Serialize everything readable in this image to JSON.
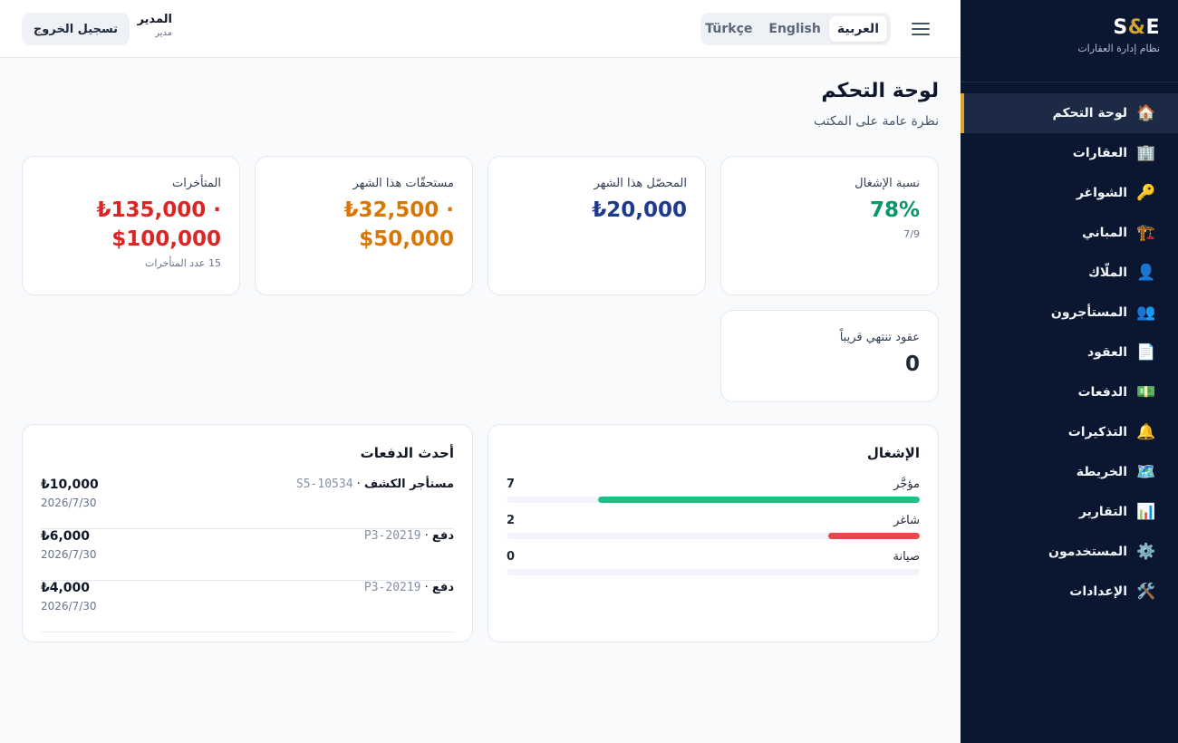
{
  "sidebar": {
    "brand_prefix": "S",
    "brand_amp": "&",
    "brand_suffix": "E",
    "subtitle": "نظام إدارة العقارات",
    "items": [
      {
        "label": "لوحة التحكم",
        "icon": "🏠",
        "icon_name": "home-icon"
      },
      {
        "label": "العقارات",
        "icon": "🏢",
        "icon_name": "building-icon"
      },
      {
        "label": "الشواغر",
        "icon": "🔑",
        "icon_name": "key-icon"
      },
      {
        "label": "المباني",
        "icon": "🏗️",
        "icon_name": "construction-icon"
      },
      {
        "label": "الملّاك",
        "icon": "👤",
        "icon_name": "user-icon"
      },
      {
        "label": "المستأجرون",
        "icon": "👥",
        "icon_name": "users-icon"
      },
      {
        "label": "العقود",
        "icon": "📄",
        "icon_name": "document-icon"
      },
      {
        "label": "الدفعات",
        "icon": "💵",
        "icon_name": "money-icon"
      },
      {
        "label": "التذكيرات",
        "icon": "🔔",
        "icon_name": "bell-icon"
      },
      {
        "label": "الخريطة",
        "icon": "🗺️",
        "icon_name": "map-icon"
      },
      {
        "label": "التقارير",
        "icon": "📊",
        "icon_name": "bar-chart-icon"
      },
      {
        "label": "المستخدمون",
        "icon": "⚙️",
        "icon_name": "gear-icon"
      },
      {
        "label": "الإعدادات",
        "icon": "🛠️",
        "icon_name": "tools-icon"
      }
    ],
    "active_index": 0
  },
  "topbar": {
    "languages": [
      "العربية",
      "English",
      "Türkçe"
    ],
    "active_language": "العربية",
    "user_name": "المدير",
    "user_role": "مدير",
    "logout_label": "تسجيل الخروج"
  },
  "page": {
    "title": "لوحة التحكم",
    "subtitle": "نظرة عامة على المكتب"
  },
  "stats": {
    "occupancy": {
      "label": "نسبة الإشغال",
      "value": "78%",
      "foot": "7/9"
    },
    "collected": {
      "label": "المحصّل هذا الشهر",
      "value": "₺20,000"
    },
    "due": {
      "label": "مستحقّات هذا الشهر",
      "value_line1": "₺32,500 ·",
      "value_line2": "$50,000"
    },
    "overdue": {
      "label": "المتأخرات",
      "value_line1": "₺135,000 ·",
      "value_line2": "$100,000",
      "foot": "15 عدد المتأخرات"
    },
    "expiring": {
      "label": "عقود تنتهي قريباً",
      "value": "0"
    }
  },
  "occupancy_panel": {
    "title": "الإشغال",
    "total": 9,
    "rows": [
      {
        "label": "مؤجَّر",
        "count": 7,
        "color": "#1fbf83"
      },
      {
        "label": "شاغر",
        "count": 2,
        "color": "#e5484d"
      },
      {
        "label": "صيانة",
        "count": 0,
        "color": "#f59e0b"
      }
    ]
  },
  "payments_panel": {
    "title": "أحدث الدفعات",
    "rows": [
      {
        "who": "مستأجر الكشف",
        "ref": "S5-10534",
        "amount": "₺10,000",
        "date": "2026/7/30"
      },
      {
        "who": "دفع",
        "ref": "P3-20219",
        "amount": "₺6,000",
        "date": "2026/7/30"
      },
      {
        "who": "دفع",
        "ref": "P3-20219",
        "amount": "₺4,000",
        "date": "2026/7/30"
      }
    ]
  }
}
